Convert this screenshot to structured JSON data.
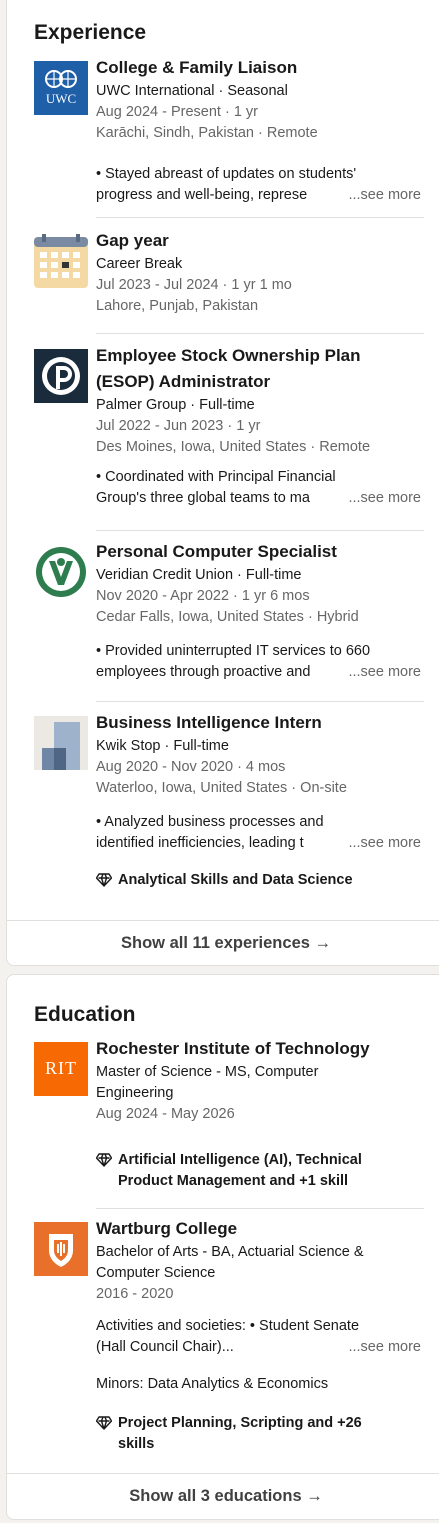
{
  "experience": {
    "title": "Experience",
    "items": [
      {
        "title": "College & Family Liaison",
        "company": "UWC International · Seasonal",
        "dates": "Aug 2024 - Present · 1 yr",
        "location": "Karāchi, Sindh, Pakistan · Remote",
        "desc_line1": "• Stayed abreast of updates on students'",
        "desc_line2": "progress and well-being, represe",
        "logo_text": "UWC",
        "logo_icon": "globe-icon"
      },
      {
        "title": "Gap year",
        "company": "Career Break",
        "dates": "Jul 2023 - Jul 2024 · 1 yr 1 mo",
        "location": "Lahore, Punjab, Pakistan",
        "logo_icon": "calendar-icon"
      },
      {
        "title_line1": "Employee Stock Ownership Plan",
        "title_line2": "(ESOP) Administrator",
        "company": "Palmer Group · Full-time",
        "dates": "Jul 2022 - Jun 2023 · 1 yr",
        "location": "Des Moines, Iowa, United States · Remote",
        "desc_line1": "• Coordinated with Principal Financial",
        "desc_line2": "Group's three global teams to ma",
        "logo_icon": "principal-logo-icon"
      },
      {
        "title": "Personal Computer Specialist",
        "company": "Veridian Credit Union · Full-time",
        "dates": "Nov 2020 - Apr 2022 · 1 yr 6 mos",
        "location": "Cedar Falls, Iowa, United States · Hybrid",
        "desc_line1": "• Provided uninterrupted IT services to 660",
        "desc_line2": "employees through proactive and",
        "logo_icon": "veridian-logo-icon"
      },
      {
        "title": "Business Intelligence Intern",
        "company": "Kwik Stop · Full-time",
        "dates": "Aug 2020 - Nov 2020 · 4 mos",
        "location": "Waterloo, Iowa, United States · On-site",
        "desc_line1": "• Analyzed business processes and",
        "desc_line2": "identified inefficiencies, leading t",
        "skills": "Analytical Skills and Data Science",
        "logo_icon": "kwikstop-logo-icon"
      }
    ],
    "see_more": "...see more",
    "show_all": "Show all 11 experiences →"
  },
  "education": {
    "title": "Education",
    "items": [
      {
        "school": "Rochester Institute of Technology",
        "degree_line1": "Master of Science - MS, Computer",
        "degree_line2": "Engineering",
        "dates": "Aug 2024 - May 2026",
        "skills_line1": "Artificial Intelligence (AI), Technical",
        "skills_line2": "Product Management and +1 skill",
        "logo_text": "RIT"
      },
      {
        "school": "Wartburg College",
        "degree_line1": "Bachelor of Arts - BA, Actuarial Science &",
        "degree_line2": "Computer Science",
        "dates": "2016 - 2020",
        "activities_line1": "Activities and societies: • Student Senate",
        "activities_line2": "(Hall Council Chair)...",
        "minors": "Minors: Data Analytics & Economics",
        "skills_line1": "Project Planning, Scripting and +26",
        "skills_line2": "skills",
        "logo_icon": "wartburg-shield-icon"
      }
    ],
    "see_more": "...see more",
    "show_all": "Show all 3 educations →"
  },
  "colors": {
    "uwc_blue": "#1f5fa8",
    "rit_orange": "#f76902",
    "wartburg_orange": "#e8702a",
    "veridian_green": "#2e7d4f",
    "principal_navy": "#1a2b3c"
  }
}
